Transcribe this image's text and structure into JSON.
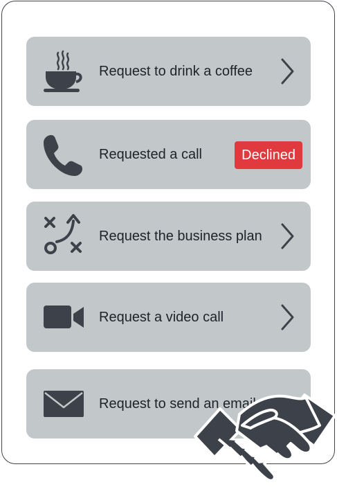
{
  "items": [
    {
      "label": "Request to drink a coffee",
      "icon": "coffee-cup-icon",
      "action": "chevron"
    },
    {
      "label": "Requested a call",
      "icon": "phone-icon",
      "action": "badge",
      "badge": "Declined"
    },
    {
      "label": "Request the business plan",
      "icon": "strategy-plan-icon",
      "action": "chevron"
    },
    {
      "label": "Request a video call",
      "icon": "video-camera-icon",
      "action": "chevron"
    },
    {
      "label": "Request to send an email",
      "icon": "envelope-icon",
      "action": "none"
    }
  ],
  "colors": {
    "card": "#c2c8c9",
    "icon": "#3d4149",
    "badge": "#e03a3e",
    "border": "#3d4149"
  },
  "decoration": {
    "icon": "handshake-icon"
  }
}
